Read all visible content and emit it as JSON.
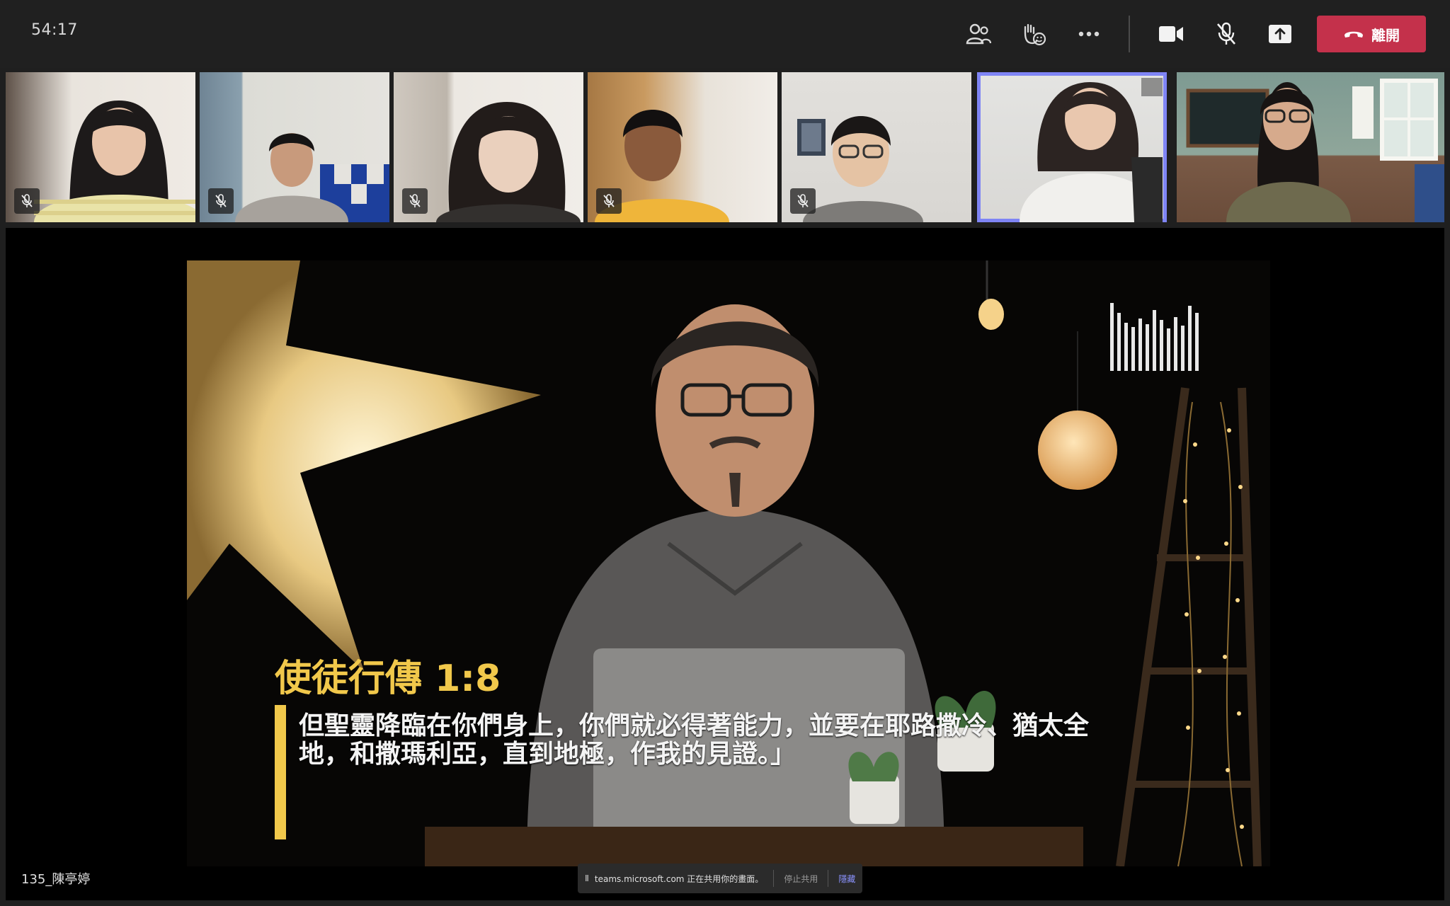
{
  "meeting": {
    "elapsed_time": "54:17"
  },
  "toolbar": {
    "icons": [
      "people-icon",
      "raise-hand-icon",
      "more-icon",
      "camera-icon",
      "mic-off-icon",
      "share-icon",
      "phone-icon"
    ],
    "leave_label": "離開",
    "leave_color": "#c4314b"
  },
  "participants": [
    {
      "muted": true,
      "active": false
    },
    {
      "muted": true,
      "active": false
    },
    {
      "muted": true,
      "active": false
    },
    {
      "muted": true,
      "active": false
    },
    {
      "muted": true,
      "active": false
    },
    {
      "muted": false,
      "active": true
    },
    {
      "muted": false,
      "active": false
    }
  ],
  "stage": {
    "verse_reference": "使徒行傳 1:8",
    "verse_line1": "但聖靈降臨在你們身上，你們就必得著能力，並要在耶路撒冷、猶太全",
    "verse_line2": "地，和撒瑪利亞，直到地極，作我的見證。」",
    "presenter_name": "135_陳亭婷",
    "accent_color": "#f1c84b"
  },
  "share_bar": {
    "pause_icon": "Ⅱ",
    "message": "teams.microsoft.com 正在共用你的畫面。",
    "stop_label": "停止共用",
    "hide_label": "隱藏"
  }
}
